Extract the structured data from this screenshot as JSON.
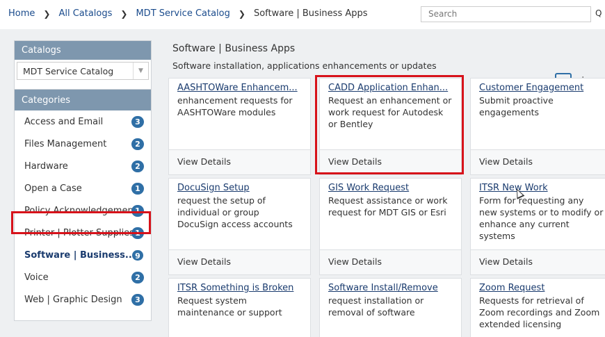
{
  "breadcrumb": {
    "items": [
      "Home",
      "All Catalogs",
      "MDT Service Catalog",
      "Software | Business Apps"
    ]
  },
  "search": {
    "placeholder": "Search"
  },
  "sidebar": {
    "catalogs_heading": "Catalogs",
    "catalog_selected": "MDT Service Catalog",
    "categories_heading": "Categories",
    "categories": [
      {
        "label": "Access and Email",
        "count": "3"
      },
      {
        "label": "Files Management",
        "count": "2"
      },
      {
        "label": "Hardware",
        "count": "2"
      },
      {
        "label": "Open a Case",
        "count": "1"
      },
      {
        "label": "Policy Acknowledgement",
        "count": "1"
      },
      {
        "label": "Printer | Plotter Supplies",
        "count": "1"
      },
      {
        "label": "Software | Business...",
        "count": "9"
      },
      {
        "label": "Voice",
        "count": "2"
      },
      {
        "label": "Web | Graphic Design",
        "count": "3"
      }
    ]
  },
  "main": {
    "title": "Software | Business Apps",
    "subtitle": "Software installation, applications enhancements or updates",
    "view_separator": "|",
    "cards": [
      {
        "title": "AASHTOWare Enhancem...",
        "desc": "enhancement requests for AASHTOWare modules",
        "footer": "View Details"
      },
      {
        "title": "CADD Application Enhan...",
        "desc": "Request an enhancement or work request for Autodesk or Bentley",
        "footer": "View Details"
      },
      {
        "title": "Customer Engagement",
        "desc": "Submit proactive engagements",
        "footer": "View Details"
      },
      {
        "title": "DocuSign Setup",
        "desc": "request the setup of individual or group DocuSign access accounts",
        "footer": "View Details"
      },
      {
        "title": "GIS Work Request",
        "desc": "Request assistance or work request for MDT GIS or Esri",
        "footer": "View Details"
      },
      {
        "title": "ITSR New Work",
        "desc": "Form for requesting any new systems or to modify or enhance any current systems",
        "footer": "View Details"
      },
      {
        "title": "ITSR Something is Broken",
        "desc": "Request system maintenance or support",
        "footer": ""
      },
      {
        "title": "Software Install/Remove",
        "desc": "request installation or removal of software",
        "footer": ""
      },
      {
        "title": "Zoom Request",
        "desc": "Requests for retrieval of Zoom recordings and Zoom extended licensing",
        "footer": ""
      }
    ]
  },
  "colors": {
    "accent": "#2f6fa6",
    "highlight": "#d7121a",
    "panel_header": "#7e97ae"
  }
}
